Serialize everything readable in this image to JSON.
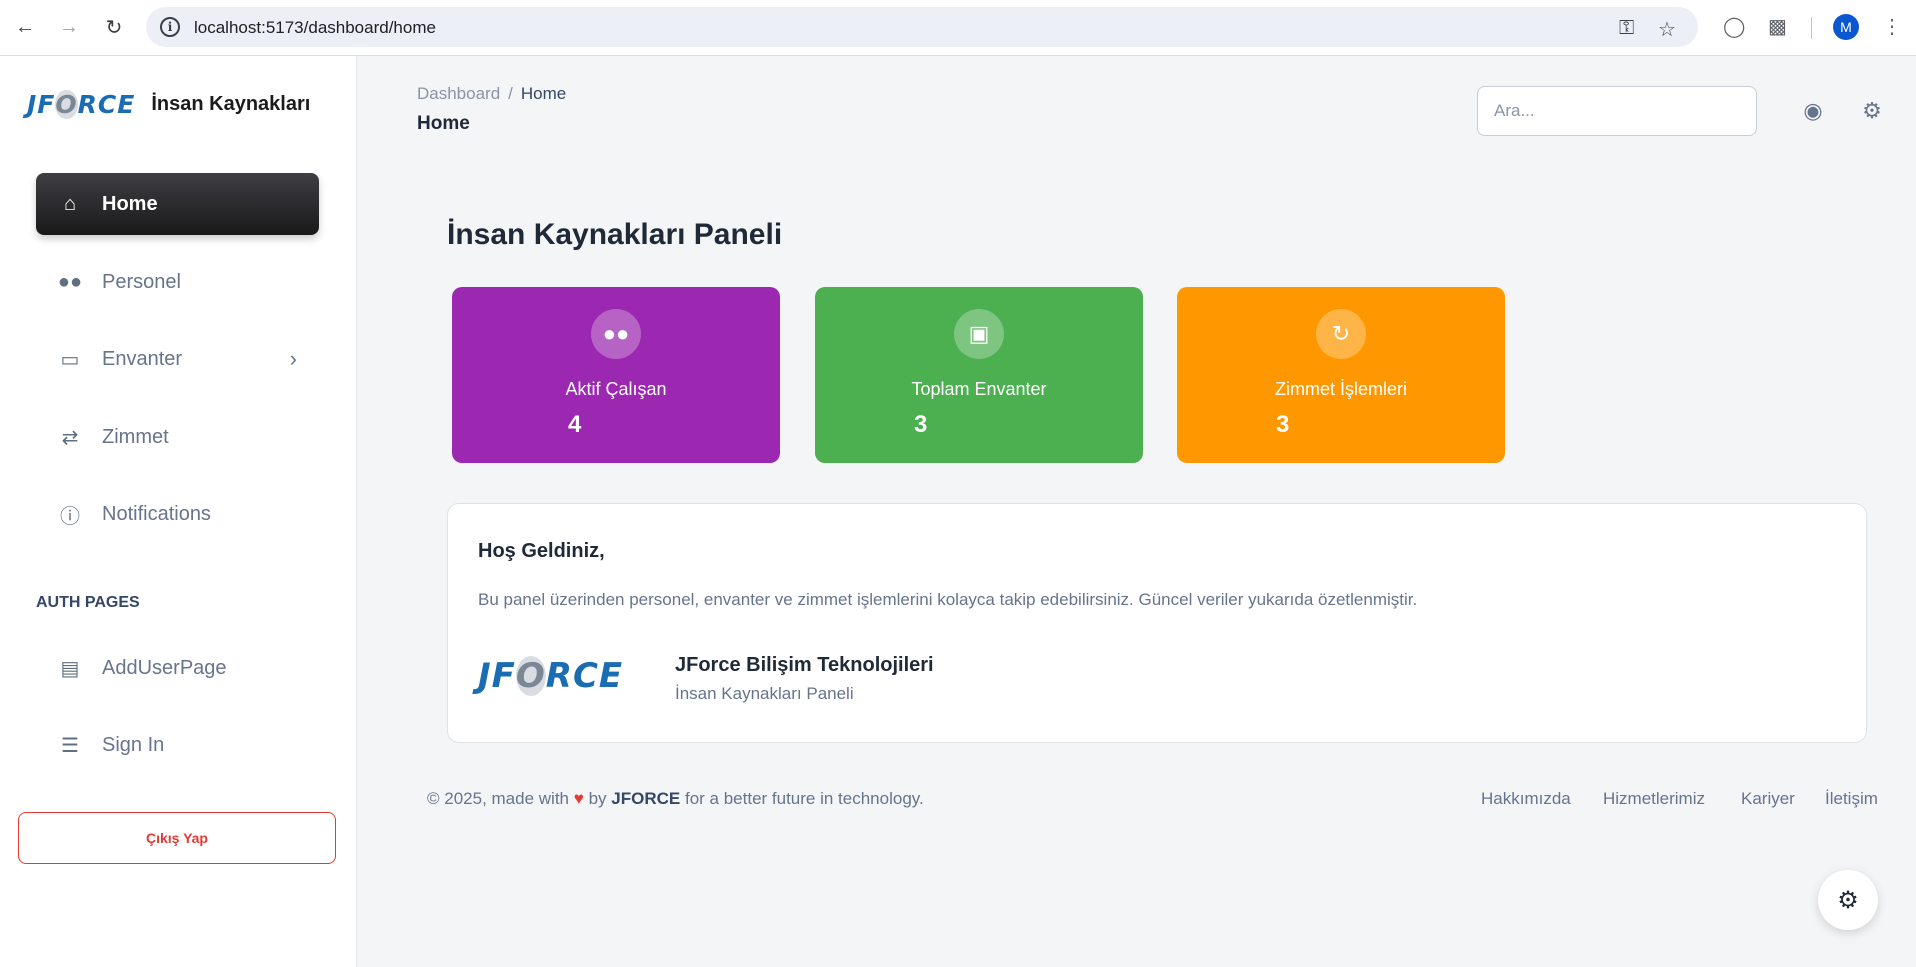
{
  "browser": {
    "url": "localhost:5173/dashboard/home",
    "profile_initial": "M"
  },
  "sidebar": {
    "brand_logo": "JFORCE",
    "brand_title": "İnsan Kaynakları",
    "items": [
      {
        "label": "Home",
        "icon": "home-icon",
        "active": true
      },
      {
        "label": "Personel",
        "icon": "users-icon"
      },
      {
        "label": "Envanter",
        "icon": "monitor-icon",
        "has_submenu": true
      },
      {
        "label": "Zimmet",
        "icon": "sync-icon"
      },
      {
        "label": "Notifications",
        "icon": "info-icon"
      }
    ],
    "section_title": "AUTH PAGES",
    "auth_items": [
      {
        "label": "AddUserPage",
        "icon": "stack-icon"
      },
      {
        "label": "Sign In",
        "icon": "server-icon"
      }
    ],
    "logout_label": "Çıkış Yap"
  },
  "topbar": {
    "breadcrumb": [
      "Dashboard",
      "Home"
    ],
    "title": "Home",
    "search_placeholder": "Ara..."
  },
  "main": {
    "heading": "İnsan Kaynakları Paneli",
    "stats": [
      {
        "label": "Aktif Çalışan",
        "value": "4",
        "color": "#9c27b0",
        "icon": "users-icon"
      },
      {
        "label": "Toplam Envanter",
        "value": "3",
        "color": "#4caf50",
        "icon": "archive-icon"
      },
      {
        "label": "Zimmet İşlemleri",
        "value": "3",
        "color": "#ff9800",
        "icon": "sync-icon"
      }
    ],
    "welcome": {
      "title": "Hoş Geldiniz,",
      "text": "Bu panel üzerinden personel, envanter ve zimmet işlemlerini kolayca takip edebilirsiniz. Güncel veriler yukarıda özetlenmiştir.",
      "company": "JForce Bilişim Teknolojileri",
      "subtitle": "İnsan Kaynakları Paneli"
    }
  },
  "footer": {
    "prefix": "© 2025, made with",
    "by": "by",
    "brand": "JFORCE",
    "suffix": "for a better future in technology.",
    "links": [
      "Hakkımızda",
      "Hizmetlerimiz",
      "Kariyer",
      "İletişim"
    ]
  },
  "colors": {
    "accent_active": "#191919",
    "logout": "#e53935"
  }
}
